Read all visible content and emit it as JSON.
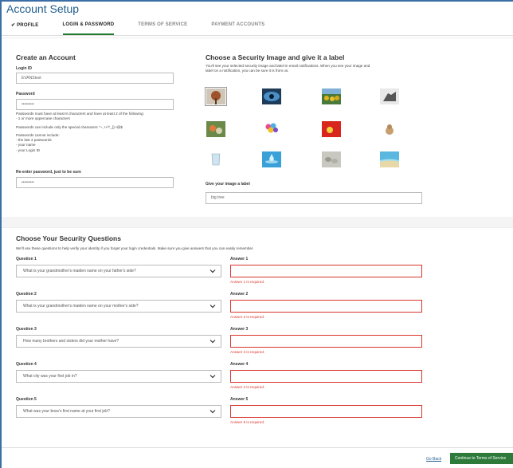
{
  "title": "Account Setup",
  "tabs": [
    {
      "label": "✔ PROFILE",
      "state": "done"
    },
    {
      "label": "LOGIN & PASSWORD",
      "state": "active"
    },
    {
      "label": "TERMS OF SERVICE",
      "state": "inactive"
    },
    {
      "label": "PAYMENT ACCOUNTS",
      "state": "inactive"
    }
  ],
  "create_account": {
    "heading": "Create an Account",
    "login_label": "Login ID",
    "login_value": "EVANStest",
    "password_label": "Password",
    "password_value": "•••••••••",
    "pw_rule_1": "Passwords must have at least 8 characters and have at least 2 of the following:",
    "pw_rule_2": "- 1 or more uppercase characters",
    "pw_rule_3": "Passwords can include only the special characters \"~,.!+/^_{}-!@$",
    "pw_cannot_1": "Passwords cannot include:",
    "pw_cannot_2": "- the last 4 passwords",
    "pw_cannot_3": "- your name",
    "pw_cannot_4": "- your Login ID",
    "reenter_label": "Re-enter password, just to be sure",
    "reenter_value": "•••••••••"
  },
  "security_image": {
    "heading": "Choose a Security Image and give it a label",
    "desc_1": "You'll see your selected security image and label in email notifications. When you see your image and",
    "desc_2": "label on a notification, you can be sure it is from us.",
    "label_title": "Give your image a label",
    "label_value": "big tree",
    "images": [
      "tree-image",
      "eye-image",
      "sunflowers-image",
      "hands-image",
      "flowers-image",
      "balloons-image",
      "red-image",
      "dog-image",
      "glass-image",
      "water-drop-image",
      "stones-image",
      "beach-image"
    ]
  },
  "questions": {
    "heading": "Choose Your Security Questions",
    "desc": "We'll use these questions to help verify your identity if you forget your login credentials. Make sure you give answers that you can easily remember.",
    "items": [
      {
        "q_label": "Question 1",
        "q_value": "What is your grandmother's maiden name on your father's side?",
        "a_label": "Answer 1",
        "error": "Answer 1 is required."
      },
      {
        "q_label": "Question 2",
        "q_value": "What is your grandmother's maiden name on your mother's side?",
        "a_label": "Answer 2",
        "error": "Answer 2 is required."
      },
      {
        "q_label": "Question 3",
        "q_value": "How many brothers and sisters did your mother have?",
        "a_label": "Answer 3",
        "error": "Answer 3 is required."
      },
      {
        "q_label": "Question 4",
        "q_value": "What city was your first job in?",
        "a_label": "Answer 4",
        "error": "Answer 4 is required."
      },
      {
        "q_label": "Question 5",
        "q_value": "What was your boss's first name at your first job?",
        "a_label": "Answer 5",
        "error": "Answer 5 is required."
      }
    ]
  },
  "footer": {
    "back_label": "Go Back",
    "continue_label": "Continue to Terms of Service"
  },
  "colors": {
    "accent": "#1f5d8e",
    "primary_button": "#2d7a3a",
    "error": "#d9342b"
  }
}
